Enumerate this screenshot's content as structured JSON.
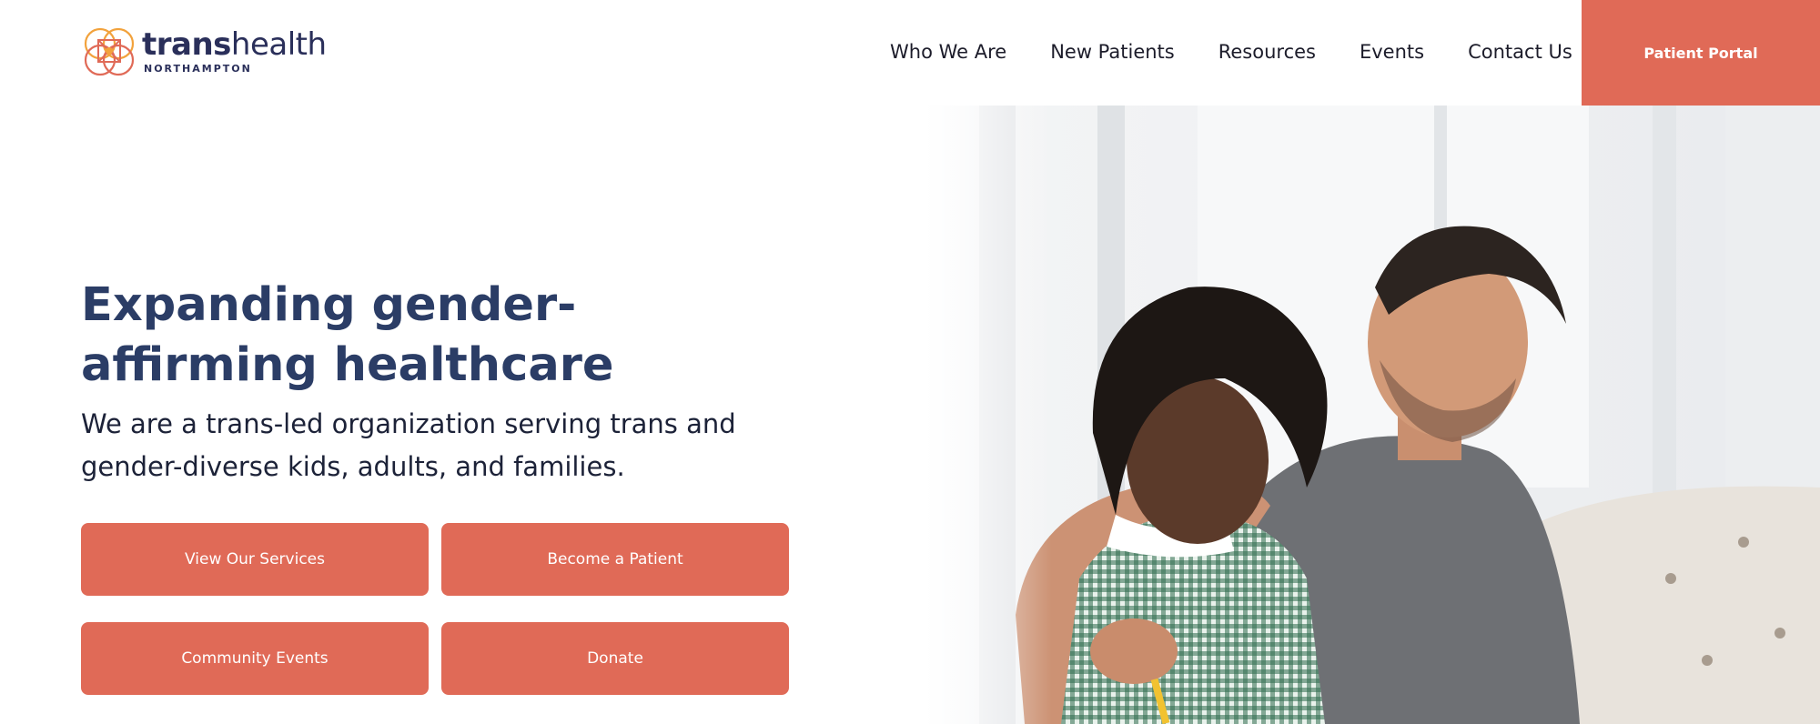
{
  "brand": {
    "name_bold": "trans",
    "name_light": "health",
    "location": "NORTHAMPTON",
    "accent_color": "#e06a57",
    "navy_color": "#2b3d66"
  },
  "nav": {
    "items": [
      {
        "label": "Who We Are"
      },
      {
        "label": "New Patients"
      },
      {
        "label": "Resources"
      },
      {
        "label": "Events"
      },
      {
        "label": "Contact Us"
      }
    ],
    "portal_label": "Patient Portal"
  },
  "hero": {
    "title": "Expanding gender-affirming healthcare",
    "subtitle": "We are a trans-led organization serving trans and gender-diverse kids, adults, and families.",
    "buttons": [
      {
        "label": "View Our Services"
      },
      {
        "label": "Become a Patient"
      },
      {
        "label": "Community Events"
      },
      {
        "label": "Donate"
      }
    ],
    "image": "photo-adult-and-child-reading"
  }
}
